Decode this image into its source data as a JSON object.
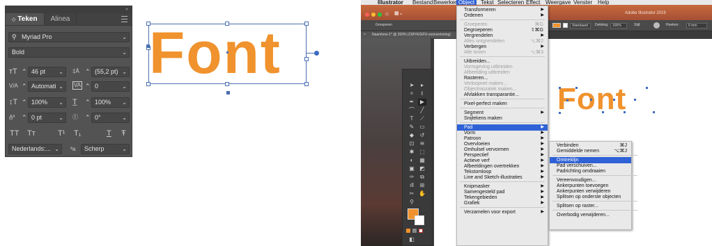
{
  "character_panel": {
    "tabs": [
      "Teken",
      "Alinea"
    ],
    "font_family": "Myriad Pro",
    "font_style": "Bold",
    "font_size": "46 pt",
    "leading": "(55,2 pt)",
    "kerning": "Automati",
    "tracking": "0",
    "vertical_scale": "100%",
    "horizontal_scale": "100%",
    "baseline_shift": "0 pt",
    "rotation": "0°",
    "language": "Nederlands:...",
    "antialias_label": "ªa",
    "antialias": "Scherp",
    "case_buttons": [
      "TT",
      "Tт",
      "T¹",
      "T₁",
      "T",
      "Ŧ"
    ]
  },
  "canvas": {
    "text": "Font"
  },
  "illustrator": {
    "menubar": [
      "Illustrator",
      "Bestand",
      "Bewerken",
      "Object",
      "Tekst",
      "Selecteren",
      "Effect",
      "Weergave",
      "Venster",
      "Help"
    ],
    "app_title": "Adobe Illustrator 2019",
    "control_bar": {
      "group_label": "Groeperen",
      "stroke_style": "Standaard",
      "opacity_label": "Dekking:",
      "opacity_value": "100%",
      "style_label": "Stijl:",
      "corners_label": "Hoeken:",
      "corners_value": "0 mm"
    },
    "doc_tab": "Naamloos-1* @ 200% (CMYK/GPU-voorvertoning)",
    "object_menu": [
      {
        "label": "Transformeren",
        "sub": true
      },
      {
        "label": "Ordenen",
        "sub": true
      },
      {
        "sep": true
      },
      {
        "label": "Groeperen",
        "shortcut": "⌘G",
        "disabled": true
      },
      {
        "label": "Degroeperen",
        "shortcut": "⇧⌘G"
      },
      {
        "label": "Vergrendelen",
        "sub": true
      },
      {
        "label": "Alles ontgrendelen",
        "shortcut": "⌥⌘2",
        "disabled": true
      },
      {
        "label": "Verbergen",
        "sub": true
      },
      {
        "label": "Alle tonen",
        "shortcut": "⌥⌘3",
        "disabled": true
      },
      {
        "sep": true
      },
      {
        "label": "Uitbreiden..."
      },
      {
        "label": "Vormgeving uitbreiden",
        "disabled": true
      },
      {
        "label": "Afbeelding uitbreiden",
        "disabled": true
      },
      {
        "label": "Rasteren..."
      },
      {
        "label": "Verloopnet maken...",
        "disabled": true
      },
      {
        "label": "Objectmozaïek maken...",
        "disabled": true
      },
      {
        "label": "Afvlakken transparantie..."
      },
      {
        "sep": true
      },
      {
        "label": "Pixel-perfect maken"
      },
      {
        "sep": true
      },
      {
        "label": "Segment",
        "sub": true
      },
      {
        "label": "Snijlekens maken"
      },
      {
        "sep": true
      },
      {
        "label": "Pad",
        "sub": true,
        "highlight": true
      },
      {
        "label": "Vorm",
        "sub": true
      },
      {
        "label": "Patroon",
        "sub": true
      },
      {
        "label": "Overvloeien",
        "sub": true
      },
      {
        "label": "Omhulsel vervormen",
        "sub": true
      },
      {
        "label": "Perspectief",
        "sub": true
      },
      {
        "label": "Actieve verf",
        "sub": true
      },
      {
        "label": "Afbeeldingen overtrekken",
        "sub": true
      },
      {
        "label": "Tekstomloop",
        "sub": true
      },
      {
        "label": "Line and Sketch-illustraties",
        "sub": true
      },
      {
        "sep": true
      },
      {
        "label": "Knipmasker",
        "sub": true
      },
      {
        "label": "Samengesteld pad",
        "sub": true
      },
      {
        "label": "Tekengebieden",
        "sub": true
      },
      {
        "label": "Grafiek",
        "sub": true
      },
      {
        "sep": true
      },
      {
        "label": "Verzamelen voor export",
        "sub": true
      }
    ],
    "path_submenu": [
      {
        "label": "Verbinden",
        "shortcut": "⌘J"
      },
      {
        "label": "Gemiddelde nemen",
        "shortcut": "⌥⌘J"
      },
      {
        "sep": true
      },
      {
        "label": "Omtreklijn",
        "highlight": true
      },
      {
        "label": "Pad verschuiven..."
      },
      {
        "label": "Padrichting omdraaien"
      },
      {
        "sep": true
      },
      {
        "label": "Vereenvoudigen..."
      },
      {
        "label": "Ankerpunten toevoegen"
      },
      {
        "label": "Ankerpunten verwijderen"
      },
      {
        "label": "Splitsen op onderste objecten"
      },
      {
        "sep": true
      },
      {
        "label": "Splitsen op raster..."
      },
      {
        "sep": true
      },
      {
        "label": "Overbodig verwijderen..."
      }
    ],
    "colors": {
      "fill": "#f0922d",
      "highlight": "#2f62d6"
    }
  }
}
